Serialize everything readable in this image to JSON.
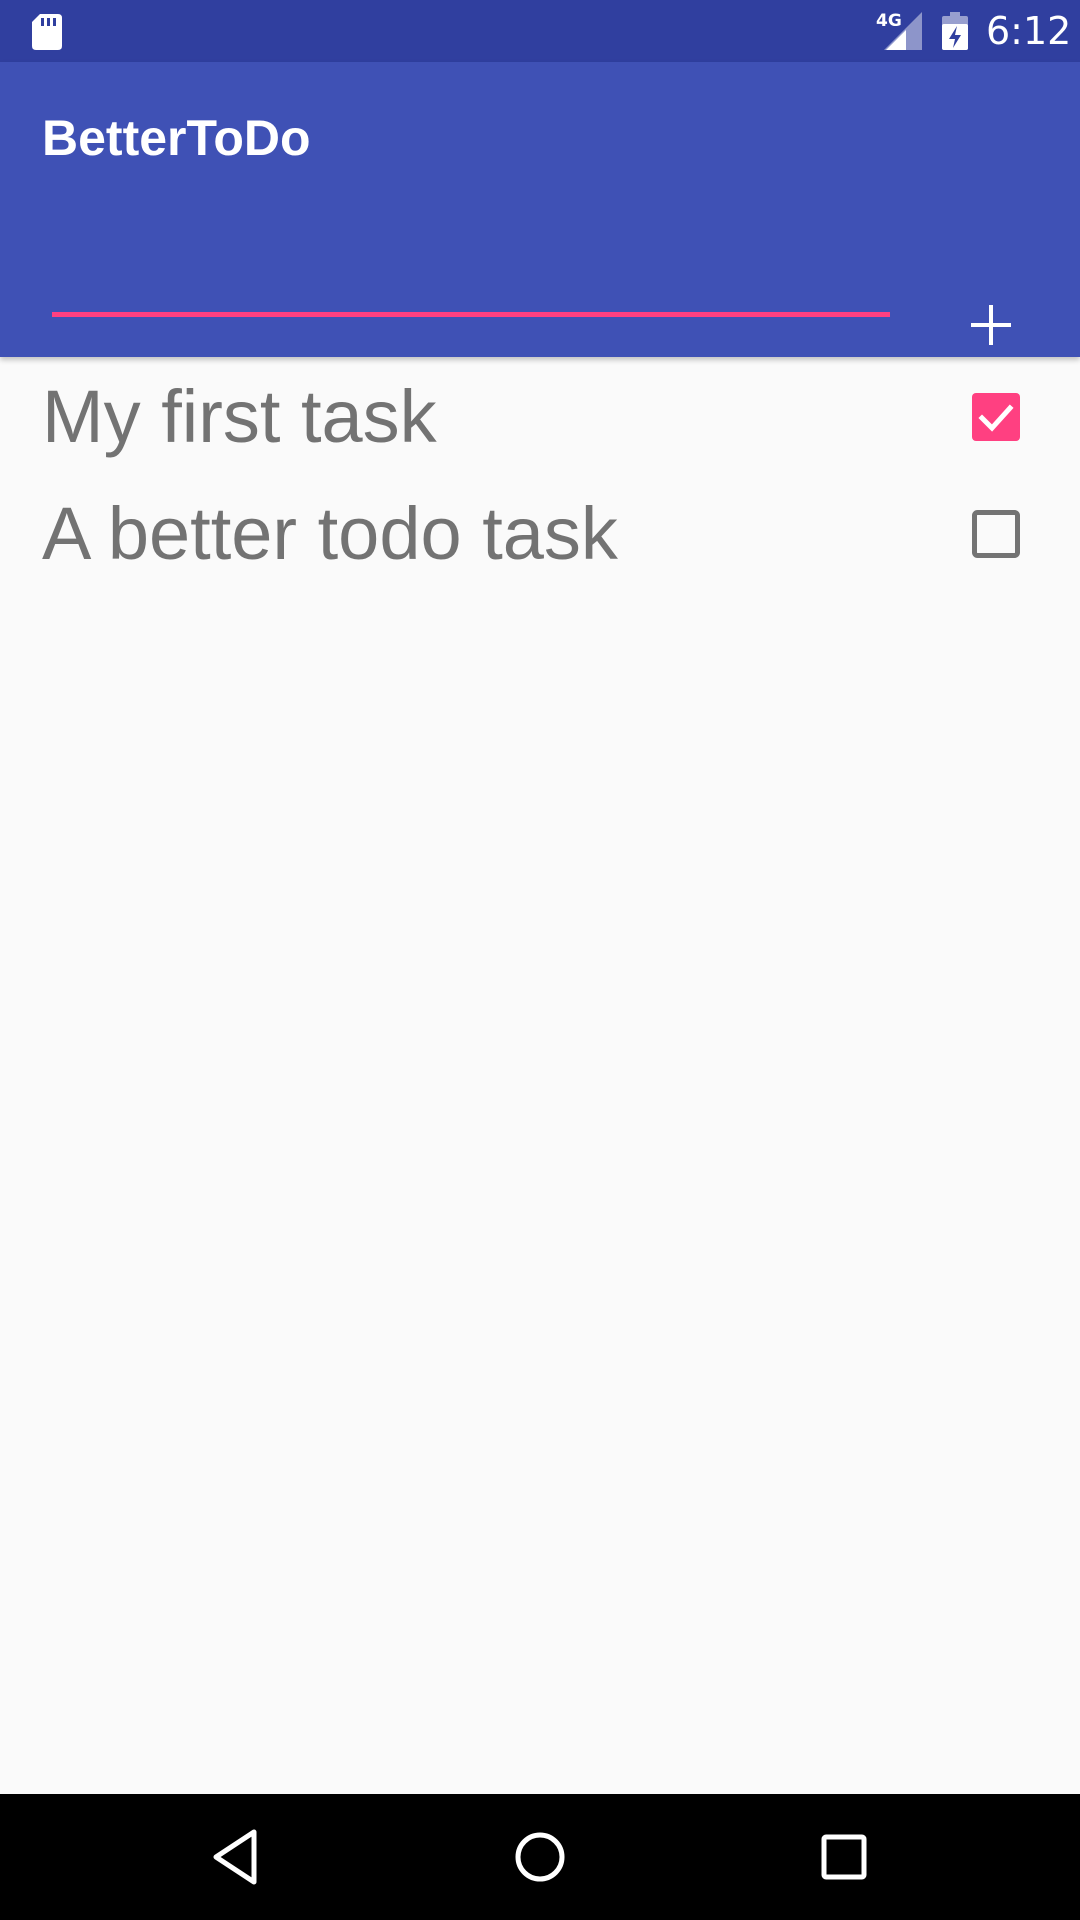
{
  "status_bar": {
    "network_type": "4G",
    "time": "6:12",
    "icons": [
      "sd-card-icon",
      "signal-icon",
      "battery-charging-icon"
    ]
  },
  "app_bar": {
    "title": "BetterToDo",
    "input_value": "",
    "add_icon": "plus-icon"
  },
  "tasks": [
    {
      "label": "My first task",
      "checked": true
    },
    {
      "label": "A better todo task",
      "checked": false
    }
  ],
  "nav_bar": {
    "icons": [
      "back-icon",
      "home-icon",
      "recents-icon"
    ]
  },
  "colors": {
    "status_bar": "#303f9f",
    "primary": "#3f51b5",
    "accent": "#ff4081",
    "background": "#fafafa",
    "task_text": "#737373"
  }
}
